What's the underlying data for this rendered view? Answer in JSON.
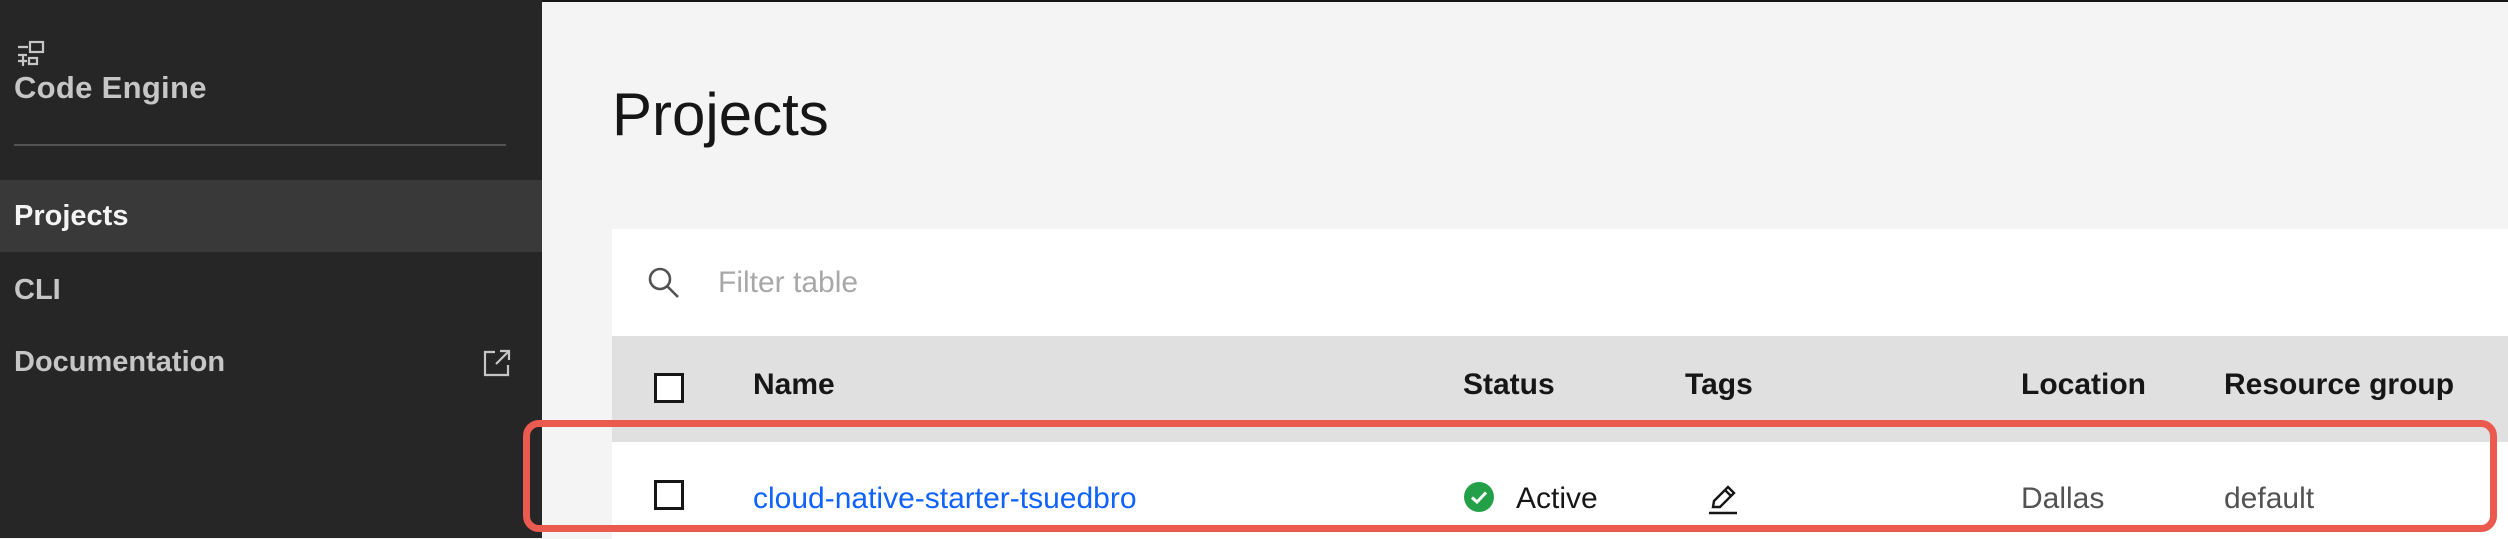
{
  "sidebar": {
    "title": "Code Engine",
    "items": [
      {
        "label": "Projects",
        "active": true
      },
      {
        "label": "CLI",
        "active": false
      },
      {
        "label": "Documentation",
        "active": false,
        "external": true
      }
    ]
  },
  "main": {
    "title": "Projects",
    "search": {
      "placeholder": "Filter table",
      "value": ""
    },
    "table": {
      "columns": [
        "Name",
        "Status",
        "Tags",
        "Location",
        "Resource group"
      ],
      "rows": [
        {
          "name": "cloud-native-starter-tsuedbro",
          "status": "Active",
          "tags": "",
          "location": "Dallas",
          "resource_group": "default"
        }
      ]
    }
  },
  "icons": {
    "brand": "code-engine-icon",
    "external": "launch-icon",
    "search": "search-icon",
    "status": "checkmark-filled-icon",
    "edit": "edit-icon"
  },
  "colors": {
    "sidebar_bg": "#262626",
    "link": "#0f62fe",
    "status_active": "#24a148",
    "highlight": "#ea5a4f"
  }
}
